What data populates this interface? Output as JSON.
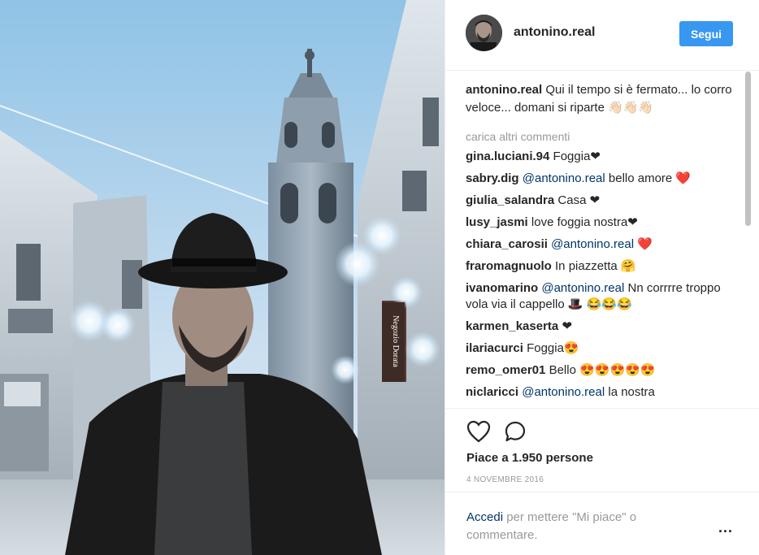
{
  "post": {
    "username": "antonino.real",
    "follow_label": "Segui",
    "caption_text": "Qui il tempo si è fermato... lo corro veloce... domani si riparte 👋🏻👋🏻👋🏻",
    "load_more": "carica altri commenti",
    "likes": "Piace a 1.950 persone",
    "date": "4 NOVEMBRE 2016",
    "login_link": "Accedi",
    "login_text": " per mettere \"Mi piace\" o commentare.",
    "more_label": "..."
  },
  "photo": {
    "sign_text": "Negozio Dorata"
  },
  "comments": [
    {
      "user": "gina.luciani.94",
      "mention": "",
      "text": "Foggia❤"
    },
    {
      "user": "sabry.dig",
      "mention": "@antonino.real",
      "text": "bello amore ❤️"
    },
    {
      "user": "giulia_salandra",
      "mention": "",
      "text": "Casa ❤"
    },
    {
      "user": "lusy_jasmi",
      "mention": "",
      "text": "love foggia nostra❤"
    },
    {
      "user": "chiara_carosii",
      "mention": "@antonino.real",
      "text": "❤️"
    },
    {
      "user": "fraromagnuolo",
      "mention": "",
      "text": "In piazzetta 🤗"
    },
    {
      "user": "ivanomarino",
      "mention": "@antonino.real",
      "text": "Nn corrrre troppo vola via il cappello 🎩 😂😂😂"
    },
    {
      "user": "karmen_kaserta",
      "mention": "",
      "text": "❤"
    },
    {
      "user": "ilariacurci",
      "mention": "",
      "text": "Foggia😍"
    },
    {
      "user": "remo_omer01",
      "mention": "",
      "text": "Bello 😍😍😍😍😍"
    },
    {
      "user": "niclaricci",
      "mention": "@antonino.real",
      "text": "la nostra"
    }
  ],
  "colors": {
    "follow_button": "#3897f0",
    "link": "#003569",
    "muted_text": "#999999"
  }
}
